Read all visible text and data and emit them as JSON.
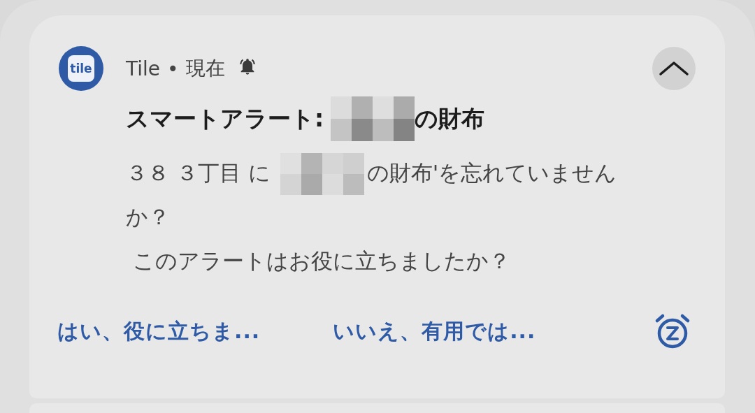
{
  "notification": {
    "logo_text": "tile",
    "app_name": "Tile",
    "separator": "•",
    "time": "現在",
    "alerting": true,
    "expanded": true,
    "title": {
      "before": "スマートアラート:",
      "after": "の財布"
    },
    "body": {
      "before": "３８ ３丁目 に",
      "after": "の財布'を忘れていません",
      "wrap": "か？"
    },
    "question": "このアラートはお役に立ちましたか？",
    "actions": [
      {
        "label": "はい、役に立ちま..."
      },
      {
        "label": "いいえ、有用では..."
      }
    ]
  }
}
